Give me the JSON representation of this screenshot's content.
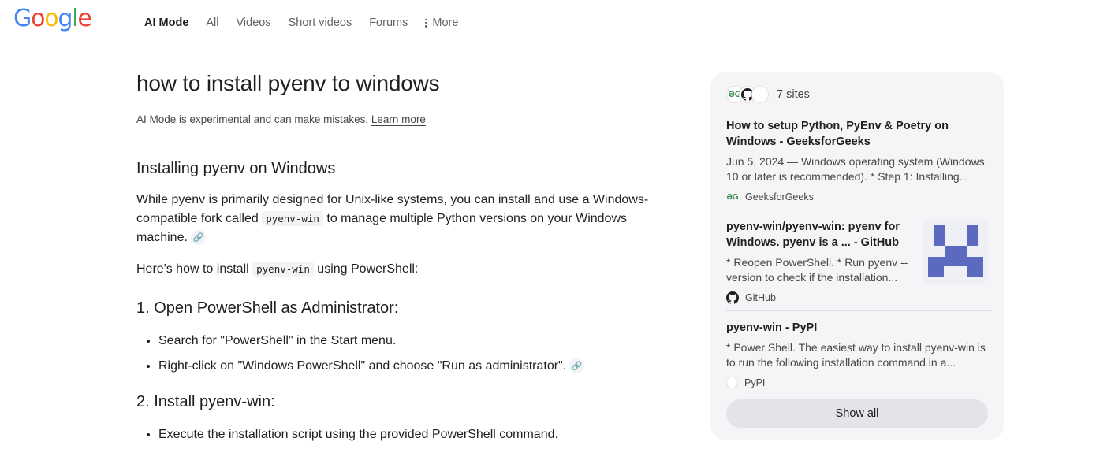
{
  "logo": {
    "text": "Google",
    "letters": [
      "G",
      "o",
      "o",
      "g",
      "l",
      "e"
    ],
    "colors": [
      "#4285F4",
      "#EA4335",
      "#FBBC05",
      "#4285F4",
      "#34A853",
      "#EA4335"
    ]
  },
  "nav": {
    "items": [
      "AI Mode",
      "All",
      "Videos",
      "Short videos",
      "Forums"
    ],
    "more_label": "More"
  },
  "main": {
    "query": "how to install pyenv to windows",
    "disclaimer": "AI Mode is experimental and can make mistakes.",
    "learn_more": "Learn more",
    "section_title": "Installing pyenv on Windows",
    "para1_a": "While pyenv is primarily designed for Unix-like systems, you can install and use a Windows-compatible fork called ",
    "para1_code": "pyenv-win",
    "para1_b": " to manage multiple Python versions on your Windows machine.",
    "para2_a": "Here's how to install ",
    "para2_code": "pyenv-win",
    "para2_b": " using PowerShell:",
    "step1": "1. Open PowerShell as Administrator:",
    "step1_bullets": [
      "Search for \"PowerShell\" in the Start menu.",
      "Right-click on \"Windows PowerShell\" and choose \"Run as administrator\"."
    ],
    "step2": "2. Install pyenv-win:",
    "step2_bullets": [
      "Execute the installation script using the provided PowerShell command."
    ]
  },
  "sources": {
    "count_label": "7 sites",
    "cards": [
      {
        "title": "How to setup Python, PyEnv & Poetry on Windows - GeeksforGeeks",
        "snippet": "Jun 5, 2024 — Windows operating system (Windows 10 or later is recommended). * Step 1: Installing...",
        "source": "GeeksforGeeks"
      },
      {
        "title": "pyenv-win/pyenv-win: pyenv for Windows. pyenv is a ... - GitHub",
        "snippet": "* Reopen PowerShell. * Run pyenv --version to check if the installation...",
        "source": "GitHub"
      },
      {
        "title": "pyenv-win - PyPI",
        "snippet": "* Power Shell. The easiest way to install pyenv-win is to run the following installation command in a...",
        "source": "PyPI"
      }
    ],
    "show_all": "Show all",
    "accent_colors": {
      "gfg": "#2f8d46",
      "thumb": "#5b6abf"
    }
  }
}
